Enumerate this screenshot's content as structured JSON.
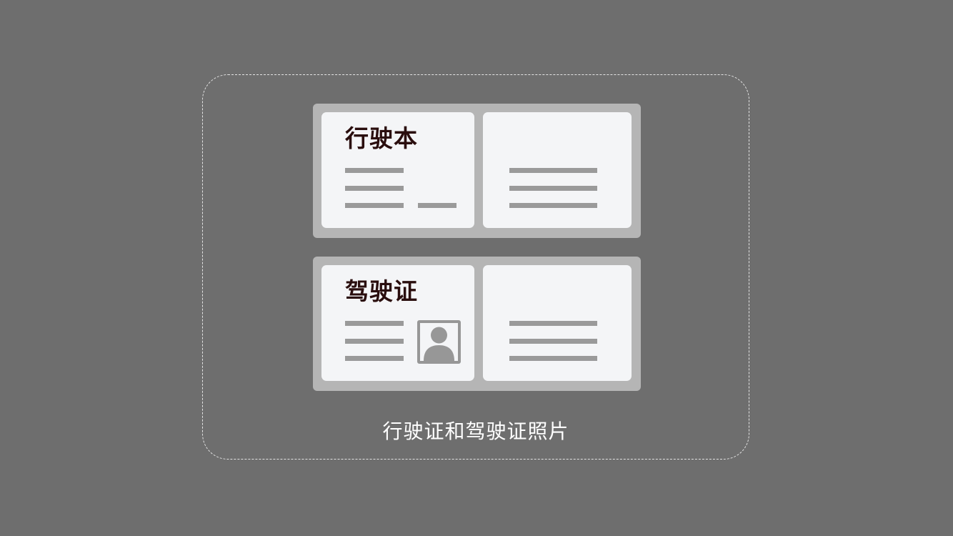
{
  "upload": {
    "caption": "行驶证和驾驶证照片"
  },
  "documents": [
    {
      "title": "行驶本"
    },
    {
      "title": "驾驶证",
      "photo_icon": "person-portrait-icon"
    }
  ],
  "colors": {
    "background": "#6e6e6e",
    "dashed_border": "#e4e4e4",
    "card_frame": "#b5b5b5",
    "card_page": "#f4f5f7",
    "title_text": "#2a0e0e",
    "placeholder_line": "#9a9a9a"
  }
}
